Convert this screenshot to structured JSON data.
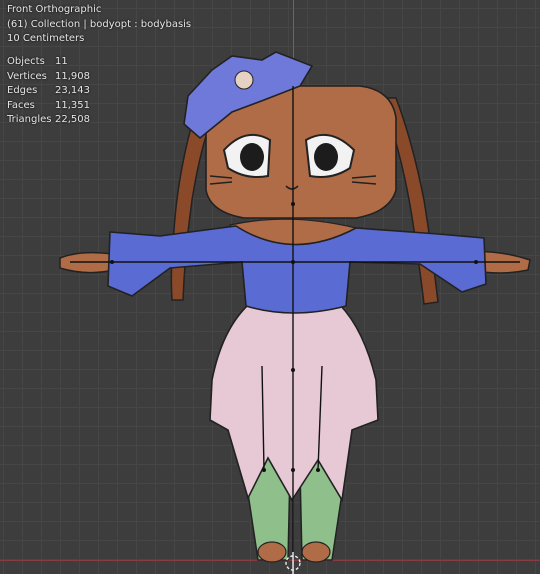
{
  "viewport": {
    "view_name": "Front Orthographic",
    "collection_line": "(61) Collection | bodyopt : bodybasis",
    "scale_line": "10 Centimeters"
  },
  "stats": [
    {
      "label": "Objects",
      "value": "11"
    },
    {
      "label": "Vertices",
      "value": "11,908"
    },
    {
      "label": "Edges",
      "value": "23,143"
    },
    {
      "label": "Faces",
      "value": "11,351"
    },
    {
      "label": "Triangles",
      "value": "22,508"
    }
  ],
  "colors": {
    "skin": "#b06c46",
    "hair": "#8a4a2a",
    "top": "#5a6cd4",
    "skirt": "#e7c9d6",
    "leggings": "#8fbf8a",
    "flower": "#6f79d9"
  }
}
